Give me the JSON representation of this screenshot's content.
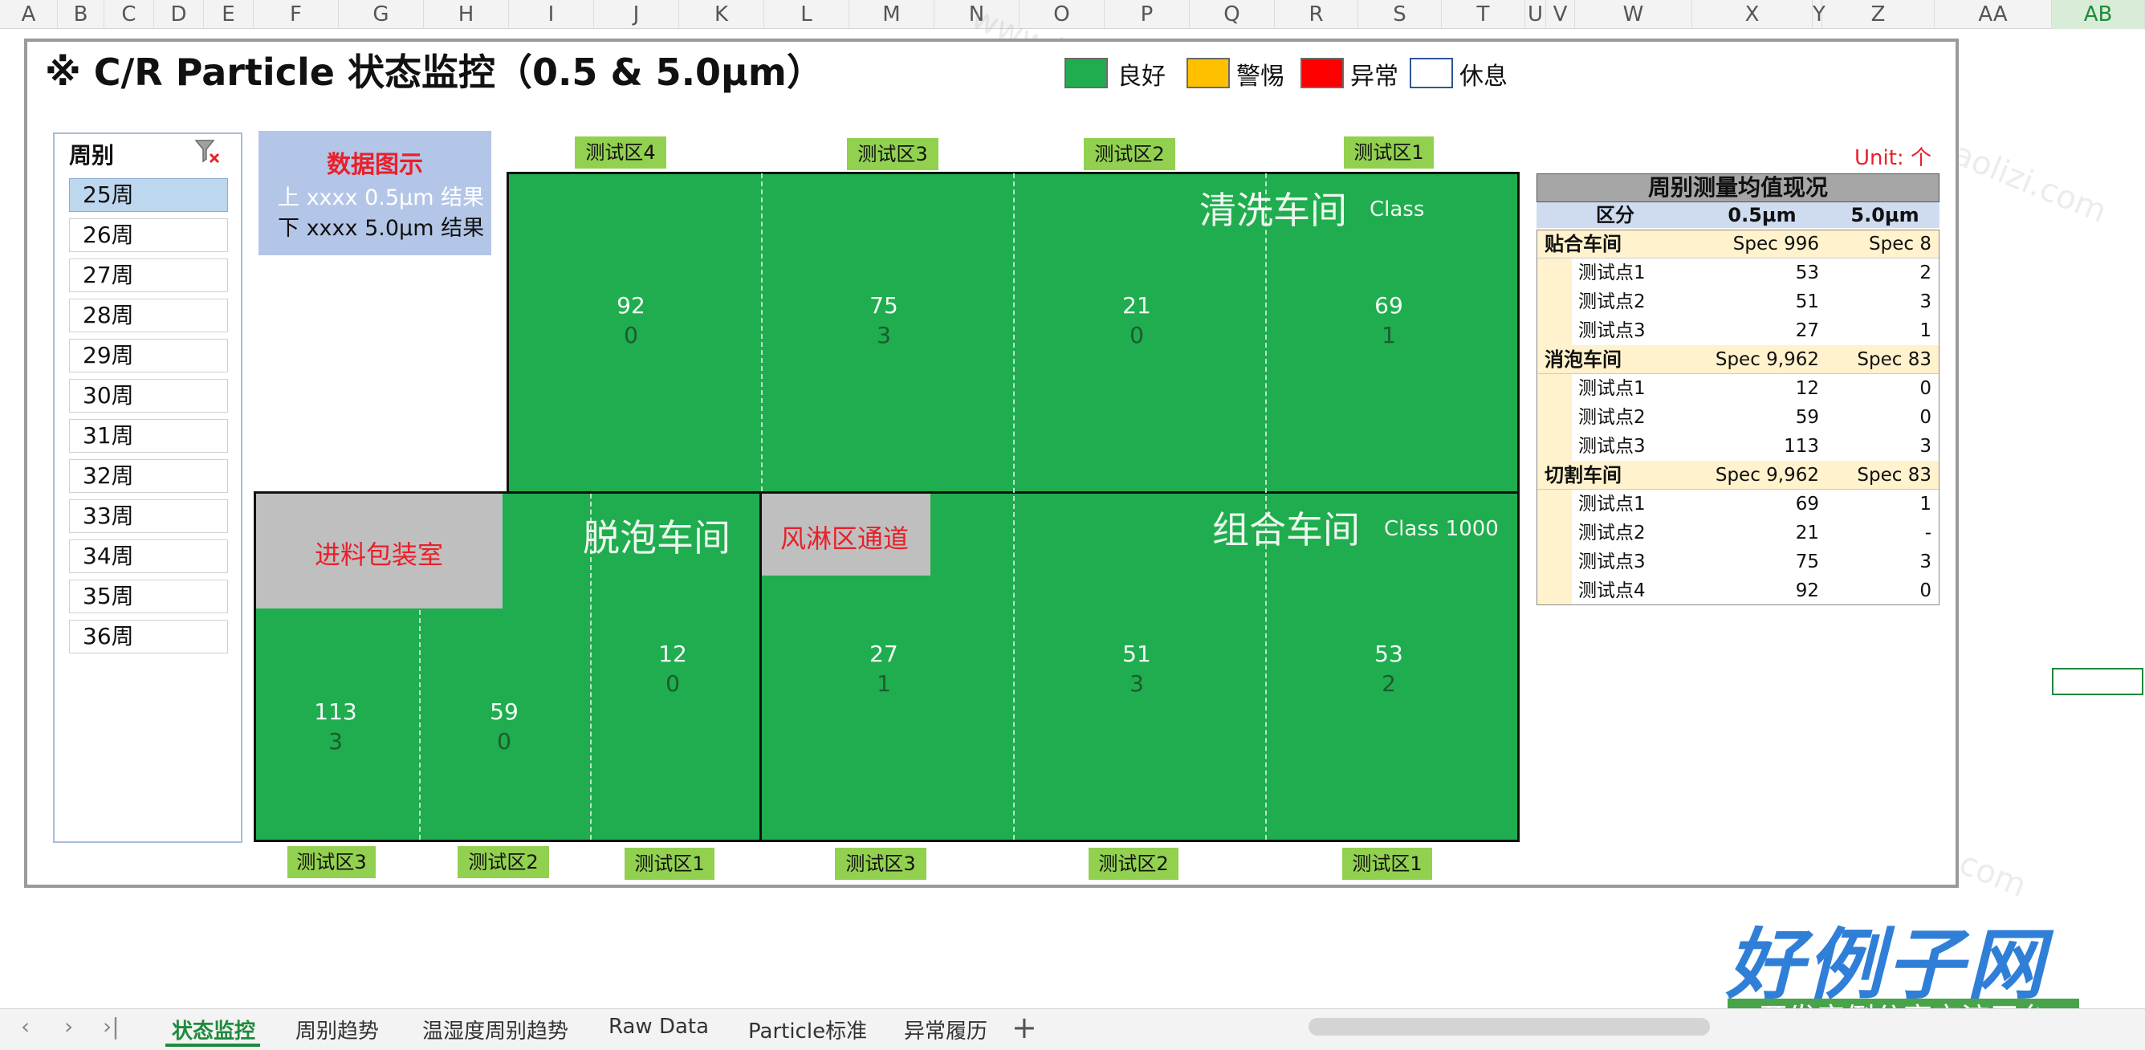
{
  "columns": [
    "A",
    "B",
    "C",
    "D",
    "E",
    "F",
    "G",
    "H",
    "I",
    "J",
    "K",
    "L",
    "M",
    "N",
    "O",
    "P",
    "Q",
    "R",
    "S",
    "T",
    "U",
    "V",
    "W",
    "X",
    "Y",
    "Z",
    "AA",
    "AB"
  ],
  "selected_column": "AB",
  "title": "※ C/R Particle 状态监控（0.5 & 5.0µm）",
  "legend": [
    {
      "label": "良好",
      "color": "#1fad4f"
    },
    {
      "label": "警惕",
      "color": "#ffc000"
    },
    {
      "label": "异常",
      "color": "#ff0000"
    },
    {
      "label": "休息",
      "color": "#ffffff"
    }
  ],
  "week_slicer": {
    "header": "周别",
    "filter_icon": "filter-clear-icon",
    "selected": "25周",
    "items": [
      "25周",
      "26周",
      "27周",
      "28周",
      "29周",
      "30周",
      "31周",
      "32周",
      "33周",
      "34周",
      "35周",
      "36周"
    ]
  },
  "info_box": {
    "title": "数据图示",
    "line1": "上 xxxx  0.5µm  结果",
    "line2": "下 xxxx  5.0µm  结果"
  },
  "unit": "Unit: 个",
  "colors": {
    "good": "#1fad4f",
    "zone_tag": "#92d050",
    "red_text": "#e8202a",
    "table_header": "#a6a6a6",
    "group_row": "#fff2cc"
  },
  "floor": {
    "cleaning": {
      "name": "清洗车间",
      "class": "Class",
      "zone_labels_top": [
        "测试区4",
        "测试区3",
        "测试区2",
        "测试区1"
      ],
      "values": [
        {
          "v05": "92",
          "v50": "0"
        },
        {
          "v05": "75",
          "v50": "3"
        },
        {
          "v05": "21",
          "v50": "0"
        },
        {
          "v05": "69",
          "v50": "1"
        }
      ]
    },
    "defoam": {
      "name": "脱泡车间",
      "room_label": "进料包装室",
      "zone_labels_bottom": [
        "测试区3",
        "测试区2",
        "测试区1"
      ],
      "values": [
        {
          "v05": "113",
          "v50": "3"
        },
        {
          "v05": "59",
          "v50": "0"
        },
        {
          "v05": "12",
          "v50": "0"
        }
      ]
    },
    "assembly": {
      "name": "组合车间",
      "class": "Class 1000",
      "room_label": "风淋区通道",
      "zone_labels_bottom": [
        "测试区3",
        "测试区2",
        "测试区1"
      ],
      "values": [
        {
          "v05": "27",
          "v50": "1"
        },
        {
          "v05": "51",
          "v50": "3"
        },
        {
          "v05": "53",
          "v50": "2"
        }
      ]
    }
  },
  "summary_table": {
    "title": "周别测量均值现况",
    "headers": [
      "区分",
      "0.5µm",
      "5.0µm"
    ],
    "groups": [
      {
        "name": "贴合车间",
        "spec05": "Spec  996",
        "spec50": "Spec  8",
        "rows": [
          {
            "label": "测试点1",
            "v05": "53",
            "v50": "2"
          },
          {
            "label": "测试点2",
            "v05": "51",
            "v50": "3"
          },
          {
            "label": "测试点3",
            "v05": "27",
            "v50": "1"
          }
        ]
      },
      {
        "name": "消泡车间",
        "spec05": "Spec  9,962",
        "spec50": "Spec  83",
        "rows": [
          {
            "label": "测试点1",
            "v05": "12",
            "v50": "0"
          },
          {
            "label": "测试点2",
            "v05": "59",
            "v50": "0"
          },
          {
            "label": "测试点3",
            "v05": "113",
            "v50": "3"
          }
        ]
      },
      {
        "name": "切割车间",
        "spec05": "Spec  9,962",
        "spec50": "Spec  83",
        "rows": [
          {
            "label": "测试点1",
            "v05": "69",
            "v50": "1"
          },
          {
            "label": "测试点2",
            "v05": "21",
            "v50": "-"
          },
          {
            "label": "测试点3",
            "v05": "75",
            "v50": "3"
          },
          {
            "label": "测试点4",
            "v05": "92",
            "v50": "0"
          }
        ]
      }
    ]
  },
  "sheet_tabs": {
    "active": "状态监控",
    "items": [
      "状态监控",
      "周别趋势",
      "温湿度周别趋势",
      "Raw Data",
      "Particle标准",
      "异常履历"
    ],
    "add_icon": "plus-icon"
  },
  "watermark": {
    "site": "www.haolizi.com",
    "logo_title": "好例子网",
    "logo_subtitle": "开发实例分享交流平台"
  }
}
